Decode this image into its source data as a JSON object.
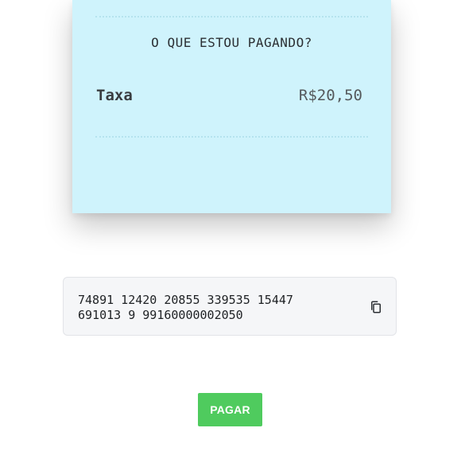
{
  "receipt": {
    "title": "O QUE ESTOU PAGANDO?",
    "item_label": "Taxa",
    "item_value": "R$20,50"
  },
  "barcode": {
    "number": "74891 12420 20855 339535 15447\n691013 9 99160000002050",
    "copy_icon": "copy-icon"
  },
  "actions": {
    "pay_label": "PAGAR"
  },
  "colors": {
    "receipt_background": "#cff3fc",
    "pay_button": "#4fcb5e",
    "code_box_background": "#f5f6f8"
  }
}
